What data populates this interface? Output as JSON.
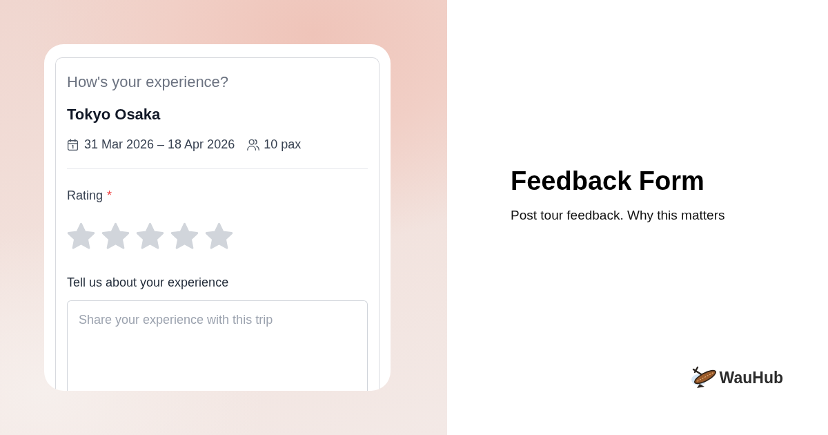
{
  "left_panel": {
    "form_card": {
      "question": "How's your experience?",
      "trip_name": "Tokyo Osaka",
      "dates": "31 Mar 2026 – 18 Apr 2026",
      "travellers": "10 pax",
      "rating": {
        "label": "Rating",
        "required_mark": "*",
        "stars": 0
      },
      "feedback": {
        "label": "Tell us about your experience",
        "placeholder": "Share your experience with this trip"
      }
    }
  },
  "right_panel": {
    "title": "Feedback Form",
    "subtitle": "Post tour feedback. Why this matters",
    "brand": {
      "name": "WauHub"
    }
  }
}
